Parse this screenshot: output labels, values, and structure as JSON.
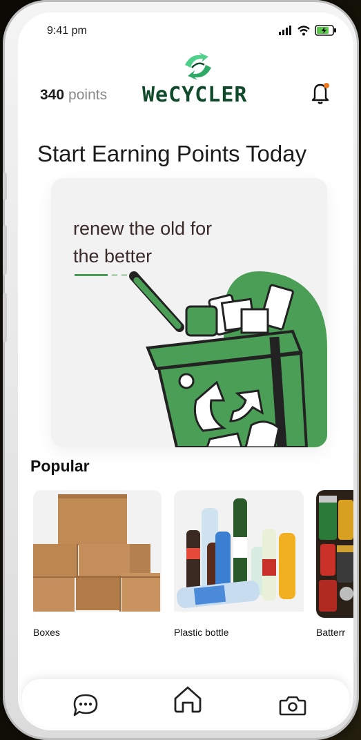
{
  "status_bar": {
    "time": "9:41 pm"
  },
  "header": {
    "points_value": "340",
    "points_unit": "points",
    "brand": "WeCYCLER",
    "brand_color": "#0f4a2a",
    "accent_color": "#4a9e55",
    "notification_dot_color": "#f07a20"
  },
  "headline": "Start Earning Points Today",
  "hero": {
    "line1": "renew the old for",
    "line2": "the better"
  },
  "popular": {
    "title": "Popular",
    "items": [
      {
        "label": "Boxes"
      },
      {
        "label": "Plastic bottle"
      },
      {
        "label": "Batterr"
      }
    ]
  },
  "nav": {
    "icons": [
      "chat-icon",
      "home-icon",
      "camera-icon"
    ]
  }
}
